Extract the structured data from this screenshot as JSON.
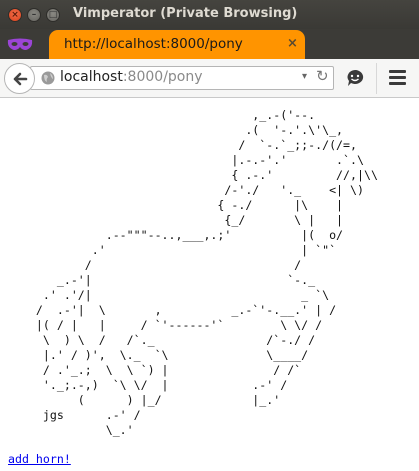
{
  "window": {
    "title": "Vimperator (Private Browsing)",
    "close": "×",
    "minimize": "–",
    "maximize": "□"
  },
  "tab": {
    "title": "http://localhost:8000/pony",
    "close": "×"
  },
  "urlbar": {
    "host": "localhost",
    "path": ":8000/pony",
    "dropdown": "▾",
    "reload": "↻"
  },
  "colors": {
    "tab_accent": "#ff9400",
    "private_mask": "#9b45d6",
    "link": "#0000ee"
  },
  "icons": [
    "private-mask-icon",
    "back-arrow-icon",
    "globe-icon",
    "dropdown-icon",
    "reload-icon",
    "chat-icon",
    "hamburger-menu-icon"
  ],
  "art": {
    "lines": [
      "                                   ,_.-('--.",
      "                                  .(  '-.'.\\'\\_,",
      "                                 /  `-.`_;;-./(/=,",
      "                                |.-.-'.'       .`.\\",
      "                                { .-.'         //,|\\\\",
      "                               /-'./   '._    <| \\)",
      "                              { -./      |\\    |",
      "                               {_/       \\ |   |",
      "              .--\"\"\"--..,___,.;'          |(  o/",
      "            .'                            | `\"`",
      "           /                             /",
      "       _.-'|                            `-._",
      "     .' .'/|                              _ `\\",
      "    /  .-'|  \\       ,          _.-`'-.__.' | /",
      "    |( / |   |     / `'------'`        \\ \\/ /",
      "     \\  ) \\  /   /`._                /`-./ /",
      "     |.' / )',  \\._  `\\              \\____/",
      "     / .'_.;  \\  \\ `) |               / /`",
      "     '._;.-,)  `\\ \\/  |            .-' /",
      "          (      ) |_/             |_.'",
      "     jgs      .-' /",
      "              \\_.'"
    ],
    "signature": "jgs"
  },
  "link": {
    "label": "add horn!"
  }
}
